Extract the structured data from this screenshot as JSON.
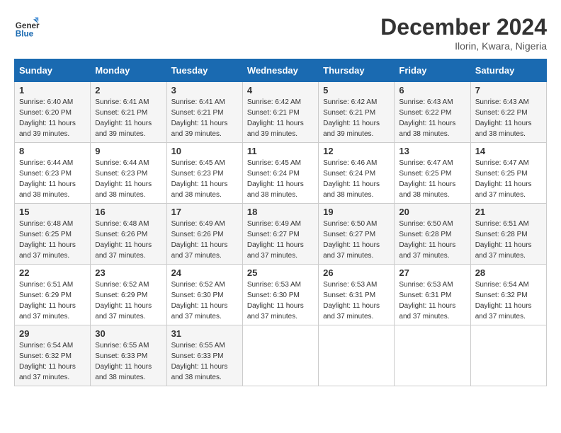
{
  "logo": {
    "text_general": "General",
    "text_blue": "Blue"
  },
  "header": {
    "month": "December 2024",
    "location": "Ilorin, Kwara, Nigeria"
  },
  "weekdays": [
    "Sunday",
    "Monday",
    "Tuesday",
    "Wednesday",
    "Thursday",
    "Friday",
    "Saturday"
  ],
  "weeks": [
    [
      {
        "day": "1",
        "sunrise": "6:40 AM",
        "sunset": "6:20 PM",
        "daylight": "11 hours and 39 minutes."
      },
      {
        "day": "2",
        "sunrise": "6:41 AM",
        "sunset": "6:21 PM",
        "daylight": "11 hours and 39 minutes."
      },
      {
        "day": "3",
        "sunrise": "6:41 AM",
        "sunset": "6:21 PM",
        "daylight": "11 hours and 39 minutes."
      },
      {
        "day": "4",
        "sunrise": "6:42 AM",
        "sunset": "6:21 PM",
        "daylight": "11 hours and 39 minutes."
      },
      {
        "day": "5",
        "sunrise": "6:42 AM",
        "sunset": "6:21 PM",
        "daylight": "11 hours and 39 minutes."
      },
      {
        "day": "6",
        "sunrise": "6:43 AM",
        "sunset": "6:22 PM",
        "daylight": "11 hours and 38 minutes."
      },
      {
        "day": "7",
        "sunrise": "6:43 AM",
        "sunset": "6:22 PM",
        "daylight": "11 hours and 38 minutes."
      }
    ],
    [
      {
        "day": "8",
        "sunrise": "6:44 AM",
        "sunset": "6:23 PM",
        "daylight": "11 hours and 38 minutes."
      },
      {
        "day": "9",
        "sunrise": "6:44 AM",
        "sunset": "6:23 PM",
        "daylight": "11 hours and 38 minutes."
      },
      {
        "day": "10",
        "sunrise": "6:45 AM",
        "sunset": "6:23 PM",
        "daylight": "11 hours and 38 minutes."
      },
      {
        "day": "11",
        "sunrise": "6:45 AM",
        "sunset": "6:24 PM",
        "daylight": "11 hours and 38 minutes."
      },
      {
        "day": "12",
        "sunrise": "6:46 AM",
        "sunset": "6:24 PM",
        "daylight": "11 hours and 38 minutes."
      },
      {
        "day": "13",
        "sunrise": "6:47 AM",
        "sunset": "6:25 PM",
        "daylight": "11 hours and 38 minutes."
      },
      {
        "day": "14",
        "sunrise": "6:47 AM",
        "sunset": "6:25 PM",
        "daylight": "11 hours and 37 minutes."
      }
    ],
    [
      {
        "day": "15",
        "sunrise": "6:48 AM",
        "sunset": "6:25 PM",
        "daylight": "11 hours and 37 minutes."
      },
      {
        "day": "16",
        "sunrise": "6:48 AM",
        "sunset": "6:26 PM",
        "daylight": "11 hours and 37 minutes."
      },
      {
        "day": "17",
        "sunrise": "6:49 AM",
        "sunset": "6:26 PM",
        "daylight": "11 hours and 37 minutes."
      },
      {
        "day": "18",
        "sunrise": "6:49 AM",
        "sunset": "6:27 PM",
        "daylight": "11 hours and 37 minutes."
      },
      {
        "day": "19",
        "sunrise": "6:50 AM",
        "sunset": "6:27 PM",
        "daylight": "11 hours and 37 minutes."
      },
      {
        "day": "20",
        "sunrise": "6:50 AM",
        "sunset": "6:28 PM",
        "daylight": "11 hours and 37 minutes."
      },
      {
        "day": "21",
        "sunrise": "6:51 AM",
        "sunset": "6:28 PM",
        "daylight": "11 hours and 37 minutes."
      }
    ],
    [
      {
        "day": "22",
        "sunrise": "6:51 AM",
        "sunset": "6:29 PM",
        "daylight": "11 hours and 37 minutes."
      },
      {
        "day": "23",
        "sunrise": "6:52 AM",
        "sunset": "6:29 PM",
        "daylight": "11 hours and 37 minutes."
      },
      {
        "day": "24",
        "sunrise": "6:52 AM",
        "sunset": "6:30 PM",
        "daylight": "11 hours and 37 minutes."
      },
      {
        "day": "25",
        "sunrise": "6:53 AM",
        "sunset": "6:30 PM",
        "daylight": "11 hours and 37 minutes."
      },
      {
        "day": "26",
        "sunrise": "6:53 AM",
        "sunset": "6:31 PM",
        "daylight": "11 hours and 37 minutes."
      },
      {
        "day": "27",
        "sunrise": "6:53 AM",
        "sunset": "6:31 PM",
        "daylight": "11 hours and 37 minutes."
      },
      {
        "day": "28",
        "sunrise": "6:54 AM",
        "sunset": "6:32 PM",
        "daylight": "11 hours and 37 minutes."
      }
    ],
    [
      {
        "day": "29",
        "sunrise": "6:54 AM",
        "sunset": "6:32 PM",
        "daylight": "11 hours and 37 minutes."
      },
      {
        "day": "30",
        "sunrise": "6:55 AM",
        "sunset": "6:33 PM",
        "daylight": "11 hours and 38 minutes."
      },
      {
        "day": "31",
        "sunrise": "6:55 AM",
        "sunset": "6:33 PM",
        "daylight": "11 hours and 38 minutes."
      },
      null,
      null,
      null,
      null
    ]
  ]
}
